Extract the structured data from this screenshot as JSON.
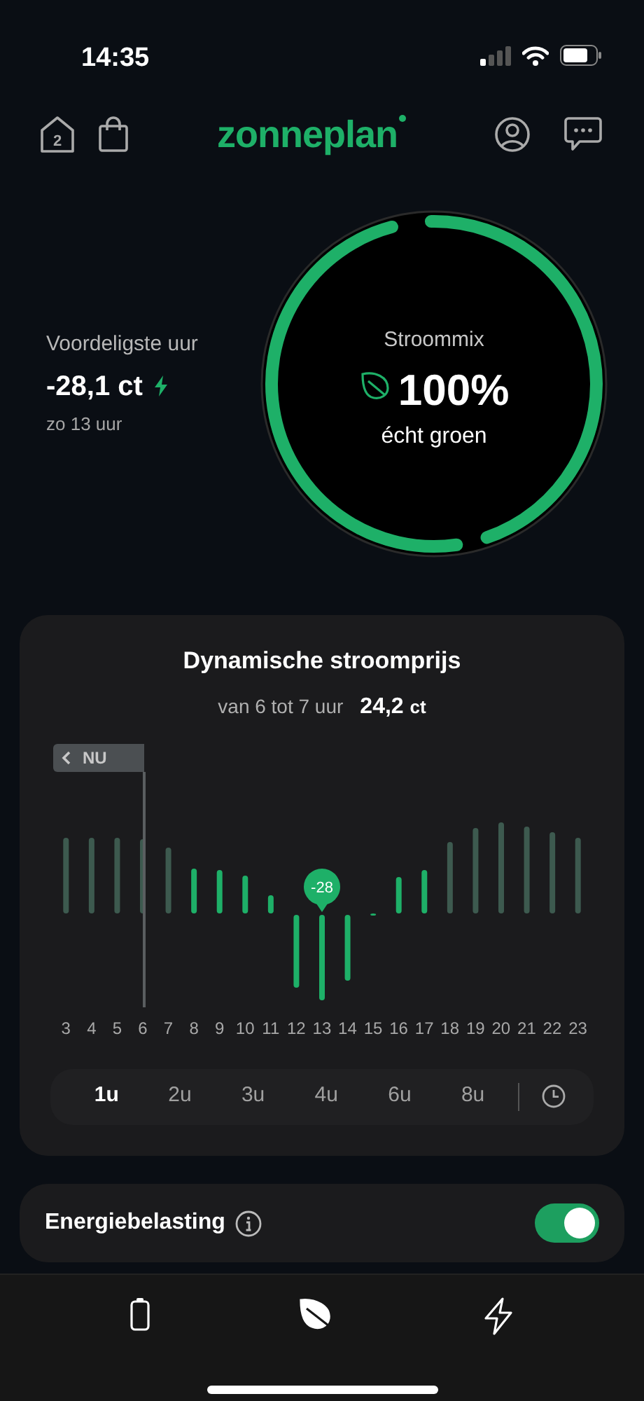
{
  "status_bar": {
    "time": "14:35"
  },
  "header": {
    "home_count": "2",
    "logo": "zonneplan"
  },
  "cheapest": {
    "label": "Voordeligste uur",
    "price": "-28,1 ct",
    "when": "zo 13 uur"
  },
  "mix": {
    "title": "Stroommix",
    "percent": "100%",
    "caption": "écht groen"
  },
  "price_card": {
    "title": "Dynamische stroomprijs",
    "range": "van 6 tot 7 uur",
    "price": "24,2",
    "unit": "ct",
    "now_label": "NU",
    "marker_label": "-28",
    "hours": [
      {
        "label": "3",
        "now": false,
        "selected": false
      },
      {
        "label": "4",
        "now": false,
        "selected": false
      },
      {
        "label": "5",
        "now": false,
        "selected": false
      },
      {
        "label": "6",
        "now": true,
        "selected": false
      },
      {
        "label": "7",
        "now": false,
        "selected": false
      },
      {
        "label": "8",
        "now": false,
        "selected": false
      },
      {
        "label": "9",
        "now": false,
        "selected": false
      },
      {
        "label": "10",
        "now": false,
        "selected": false
      },
      {
        "label": "11",
        "now": false,
        "selected": false
      },
      {
        "label": "12",
        "now": false,
        "selected": false
      },
      {
        "label": "13",
        "now": false,
        "selected": true
      },
      {
        "label": "14",
        "now": false,
        "selected": false
      },
      {
        "label": "15",
        "now": false,
        "selected": false
      },
      {
        "label": "16",
        "now": false,
        "selected": false
      },
      {
        "label": "17",
        "now": false,
        "selected": false
      },
      {
        "label": "18",
        "now": false,
        "selected": false
      },
      {
        "label": "19",
        "now": false,
        "selected": false
      },
      {
        "label": "20",
        "now": false,
        "selected": false
      },
      {
        "label": "21",
        "now": false,
        "selected": false
      },
      {
        "label": "22",
        "now": false,
        "selected": false
      },
      {
        "label": "23",
        "now": false,
        "selected": false
      }
    ]
  },
  "periods": [
    {
      "label": "1u",
      "selected": true
    },
    {
      "label": "2u",
      "selected": false
    },
    {
      "label": "3u",
      "selected": false
    },
    {
      "label": "4u",
      "selected": false
    },
    {
      "label": "6u",
      "selected": false
    },
    {
      "label": "8u",
      "selected": false
    }
  ],
  "energy_tax": {
    "label": "Energiebelasting",
    "on": true
  },
  "nav": [
    {
      "kind": "battery",
      "selected": false
    },
    {
      "kind": "leaf",
      "selected": true
    },
    {
      "kind": "bolt",
      "selected": false
    }
  ]
}
